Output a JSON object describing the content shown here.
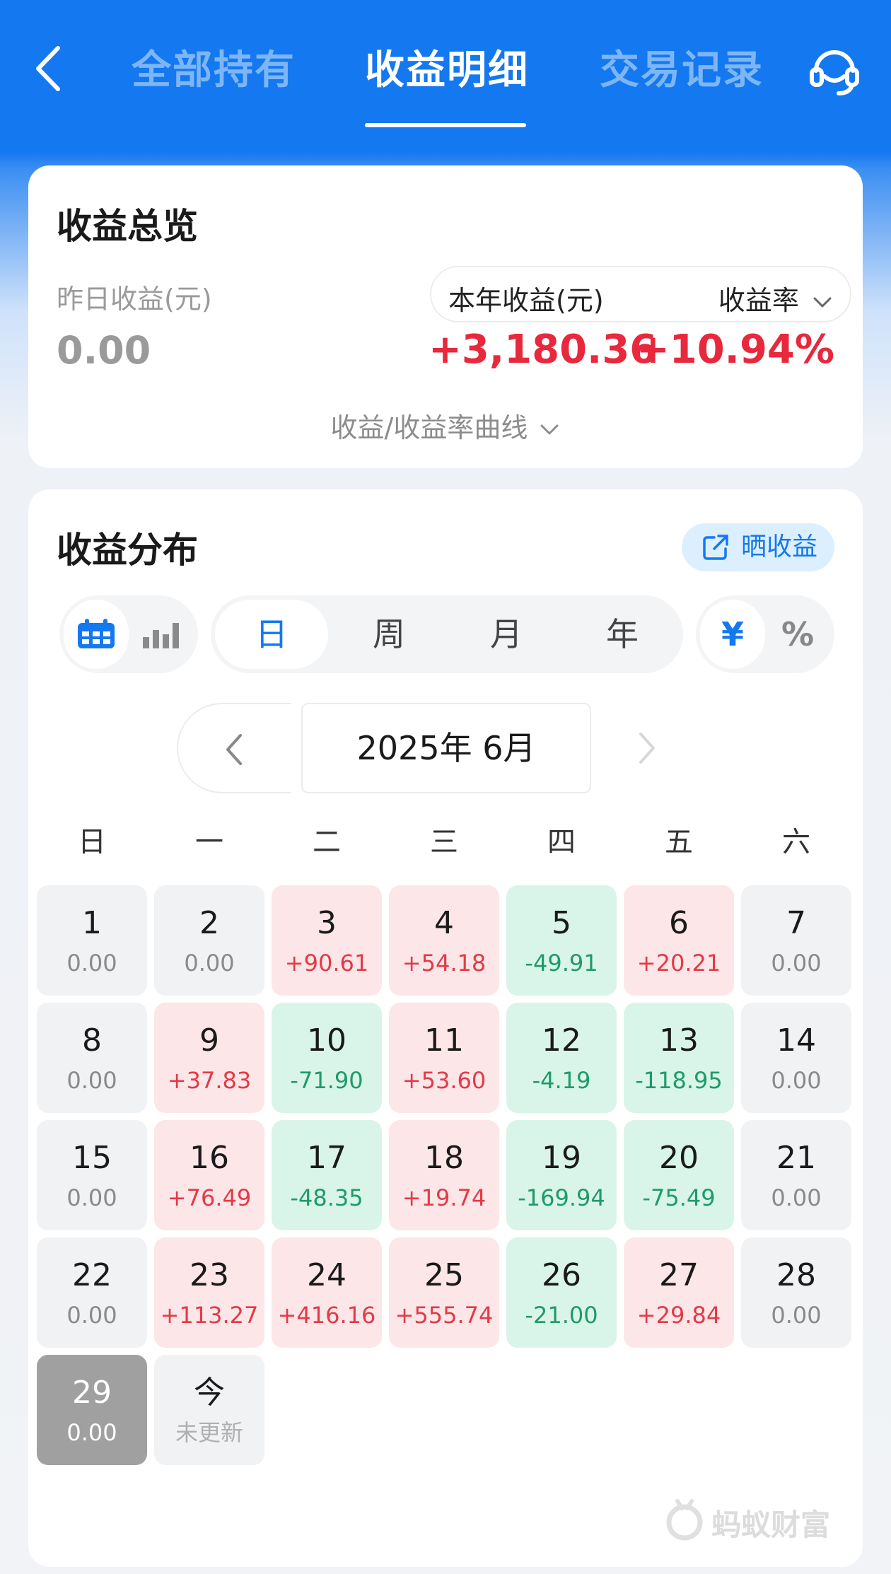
{
  "header": {
    "tabs": [
      "全部持有",
      "收益明细",
      "交易记录"
    ],
    "active_tab": 1
  },
  "overview": {
    "title": "收益总览",
    "yesterday_label": "昨日收益(元)",
    "yesterday_value": "0.00",
    "year_label": "本年收益(元)",
    "rate_label": "收益率",
    "year_value": "+3,180.36",
    "rate_value": "+10.94%",
    "curve_link": "收益/收益率曲线"
  },
  "distribution": {
    "title": "收益分布",
    "share_label": "晒收益",
    "periods": [
      "日",
      "周",
      "月",
      "年"
    ],
    "active_period": 0,
    "units": [
      "¥",
      "%"
    ],
    "active_unit": 0,
    "month_label": "2025年 6月",
    "weekdays": [
      "日",
      "一",
      "二",
      "三",
      "四",
      "五",
      "六"
    ],
    "days": [
      {
        "day": "1",
        "value": "0.00",
        "kind": "zero"
      },
      {
        "day": "2",
        "value": "0.00",
        "kind": "zero"
      },
      {
        "day": "3",
        "value": "+90.61",
        "kind": "pos"
      },
      {
        "day": "4",
        "value": "+54.18",
        "kind": "pos"
      },
      {
        "day": "5",
        "value": "-49.91",
        "kind": "neg"
      },
      {
        "day": "6",
        "value": "+20.21",
        "kind": "pos"
      },
      {
        "day": "7",
        "value": "0.00",
        "kind": "zero"
      },
      {
        "day": "8",
        "value": "0.00",
        "kind": "zero"
      },
      {
        "day": "9",
        "value": "+37.83",
        "kind": "pos"
      },
      {
        "day": "10",
        "value": "-71.90",
        "kind": "neg"
      },
      {
        "day": "11",
        "value": "+53.60",
        "kind": "pos"
      },
      {
        "day": "12",
        "value": "-4.19",
        "kind": "neg"
      },
      {
        "day": "13",
        "value": "-118.95",
        "kind": "neg"
      },
      {
        "day": "14",
        "value": "0.00",
        "kind": "zero"
      },
      {
        "day": "15",
        "value": "0.00",
        "kind": "zero"
      },
      {
        "day": "16",
        "value": "+76.49",
        "kind": "pos"
      },
      {
        "day": "17",
        "value": "-48.35",
        "kind": "neg"
      },
      {
        "day": "18",
        "value": "+19.74",
        "kind": "pos"
      },
      {
        "day": "19",
        "value": "-169.94",
        "kind": "neg"
      },
      {
        "day": "20",
        "value": "-75.49",
        "kind": "neg"
      },
      {
        "day": "21",
        "value": "0.00",
        "kind": "zero"
      },
      {
        "day": "22",
        "value": "0.00",
        "kind": "zero"
      },
      {
        "day": "23",
        "value": "+113.27",
        "kind": "pos"
      },
      {
        "day": "24",
        "value": "+416.16",
        "kind": "pos"
      },
      {
        "day": "25",
        "value": "+555.74",
        "kind": "pos"
      },
      {
        "day": "26",
        "value": "-21.00",
        "kind": "neg"
      },
      {
        "day": "27",
        "value": "+29.84",
        "kind": "pos"
      },
      {
        "day": "28",
        "value": "0.00",
        "kind": "zero"
      },
      {
        "day": "29",
        "value": "0.00",
        "kind": "today"
      },
      {
        "day": "今",
        "value": "未更新",
        "kind": "nodata"
      }
    ]
  },
  "brand": {
    "name": "蚂蚁财富"
  },
  "colors": {
    "primary": "#1478f0",
    "gain": "#e8283c",
    "loss": "#1f9a6a"
  },
  "icons": [
    "back-arrow-icon",
    "headset-icon",
    "calendar-icon",
    "bar-chart-icon",
    "share-icon",
    "chevron-down-icon",
    "chevron-left-icon",
    "chevron-right-icon",
    "ant-logo-icon"
  ]
}
